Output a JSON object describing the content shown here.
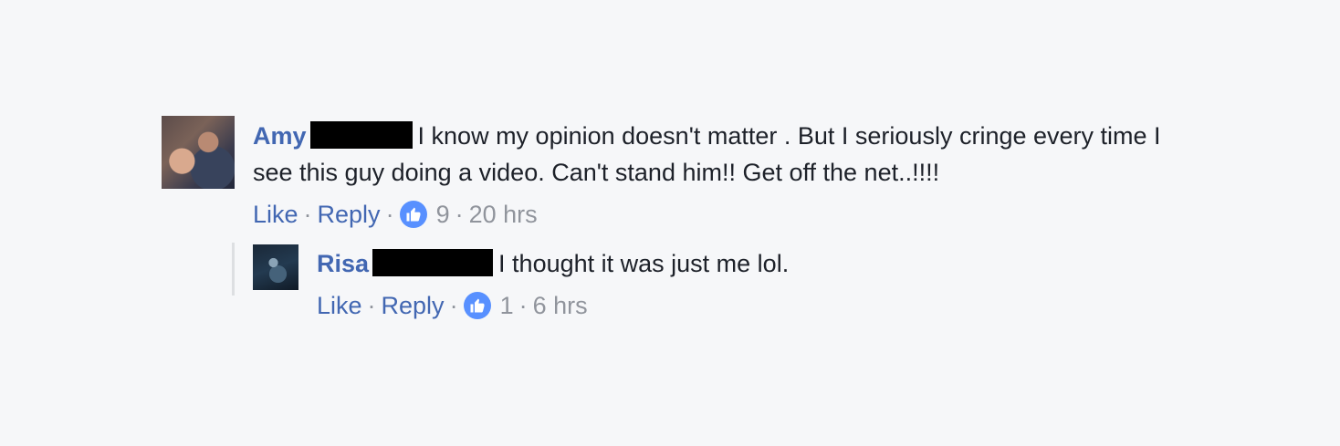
{
  "comments": [
    {
      "author": "Amy",
      "text": "I know my opinion doesn't matter . But I seriously cringe every time I see this guy doing a video. Can't stand him!! Get off the net..!!!!",
      "like_label": "Like",
      "reply_label": "Reply",
      "reaction_count": "9",
      "timestamp": "20 hrs",
      "reaction_icon": "thumbs-up-icon"
    },
    {
      "author": "Risa",
      "text": "I thought it was just me lol.",
      "like_label": "Like",
      "reply_label": "Reply",
      "reaction_count": "1",
      "timestamp": "6 hrs",
      "reaction_icon": "thumbs-up-icon"
    }
  ],
  "separator": "·",
  "colors": {
    "background": "#f6f7f9",
    "link": "#4267b2",
    "meta": "#90949c",
    "text": "#1d2129",
    "reaction": "#5890ff"
  }
}
